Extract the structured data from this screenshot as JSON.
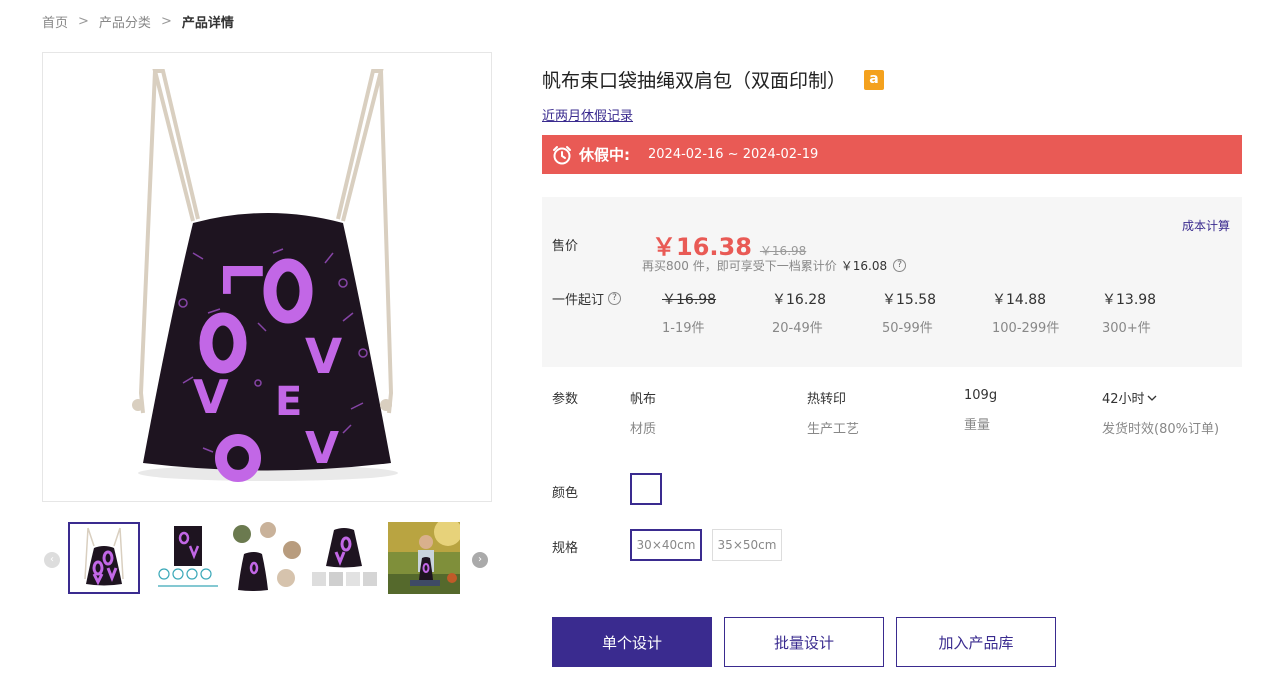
{
  "breadcrumb": {
    "home": "首页",
    "category": "产品分类",
    "current": "产品详情",
    "separator": ">"
  },
  "product": {
    "title": "帆布束口袋抽绳双肩包（双面印制）",
    "marketplace_badge": "a",
    "vacation_link": "近两月休假记录"
  },
  "vacation": {
    "label": "休假中:",
    "range": "2024-02-16 ~ 2024-02-19"
  },
  "pricing": {
    "sale_label": "售价",
    "cost_link": "成本计算",
    "price": "￥16.38",
    "original_price": "￥16.98",
    "note_prefix": "再买800 件，即可享受下一档累计价",
    "note_value": "￥16.08",
    "tier_label": "一件起订",
    "tiers": [
      {
        "price": "￥16.98",
        "range": "1-19件",
        "struck": true
      },
      {
        "price": "￥16.28",
        "range": "20-49件",
        "struck": false
      },
      {
        "price": "￥15.58",
        "range": "50-99件",
        "struck": false
      },
      {
        "price": "￥14.88",
        "range": "100-299件",
        "struck": false
      },
      {
        "price": "￥13.98",
        "range": "300+件",
        "struck": false
      }
    ]
  },
  "params": {
    "label": "参数",
    "items": [
      {
        "value": "帆布",
        "key": "材质"
      },
      {
        "value": "热转印",
        "key": "生产工艺"
      },
      {
        "value": "109g",
        "key": "重量"
      },
      {
        "value": "42小时",
        "key": "发货时效(80%订单)"
      }
    ]
  },
  "options": {
    "color_label": "颜色",
    "color_value": "#ffffff",
    "size_label": "规格",
    "sizes": [
      "30×40cm",
      "35×50cm"
    ],
    "selected_size": "30×40cm"
  },
  "actions": {
    "single_design": "单个设计",
    "batch_design": "批量设计",
    "add_library": "加入产品库"
  },
  "icons": {
    "alarm": "alarm-clock-icon",
    "help": "question-circle-icon",
    "chevron": "chevron-down-icon",
    "prev": "chevron-left-icon",
    "next": "chevron-right-icon"
  },
  "colors": {
    "accent": "#3a2b8f",
    "price_red": "#e95a55",
    "banner": "#e95a55",
    "amazon": "#f4a11d",
    "bag": "#1e1420",
    "print_pink": "#c267e6"
  }
}
